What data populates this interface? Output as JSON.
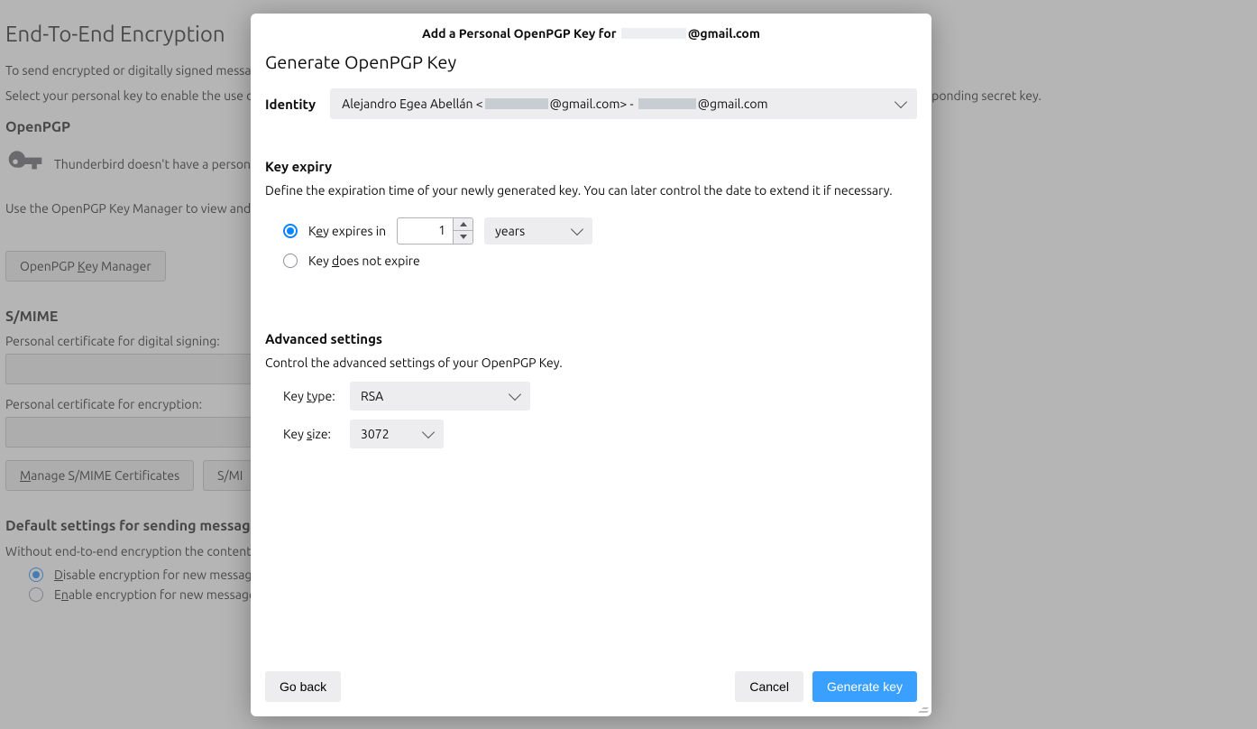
{
  "bg": {
    "title": "End-To-End Encryption",
    "p1": "To send encrypted or digitally signed messages, you need to configure an encryption technology, either OpenPGP or S/MIME.",
    "p2": "Select your personal key to enable the use of OpenPGP, or your personal certificate to enable the use of S/MIME. For a personal key or certificate you own the corresponding secret key.",
    "openpgp_heading": "OpenPGP",
    "no_key_text": "Thunderbird doesn't have a personal OpenPGP key for",
    "key_manager_desc": "Use the OpenPGP Key Manager to view and manage public keys of your correspondents and all other keys not listed above.",
    "key_manager_btn_pre": "OpenPGP ",
    "key_manager_btn_ul": "K",
    "key_manager_btn_post": "ey Manager",
    "smime_heading": "S/MIME",
    "cert_sign_label": "Personal certificate for digital signing:",
    "cert_enc_label": "Personal certificate for encryption:",
    "manage_smime_ul": "M",
    "manage_smime_post": "anage S/MIME Certificates",
    "smime_sec_pre": "S/MI",
    "defaults_heading": "Default settings for sending messages",
    "defaults_desc": "Without end-to-end encryption the contents of messages are easily exposed to your email provider and to mass surveillance.",
    "disable_ul": "D",
    "disable_post": "isable encryption for new messages",
    "enable_pre": "E",
    "enable_ul": "n",
    "enable_post": "able encryption for new messages"
  },
  "modal": {
    "title_pre": "Add a Personal OpenPGP Key for",
    "title_post": "@gmail.com",
    "heading": "Generate OpenPGP Key",
    "identity_label": "Identity",
    "identity_name": "Alejandro Egea Abellán <",
    "identity_mid": "@gmail.com> -",
    "identity_end": "@gmail.com",
    "expiry_heading": "Key expiry",
    "expiry_desc": "Define the expiration time of your newly generated key. You can later control the date to extend it if necessary.",
    "expires_in_pre": "K",
    "expires_in_ul": "e",
    "expires_in_post": "y expires in",
    "expiry_value": "1",
    "expiry_unit": "years",
    "not_expire_pre": "Key ",
    "not_expire_ul": "d",
    "not_expire_post": "oes not expire",
    "adv_heading": "Advanced settings",
    "adv_desc": "Control the advanced settings of your OpenPGP Key.",
    "key_type_pre": "Key ",
    "key_type_ul": "t",
    "key_type_post": "ype:",
    "key_type_value": "RSA",
    "key_size_pre": "Key ",
    "key_size_ul": "s",
    "key_size_post": "ize:",
    "key_size_value": "3072",
    "go_back": "Go back",
    "cancel": "Cancel",
    "generate": "Generate key"
  }
}
